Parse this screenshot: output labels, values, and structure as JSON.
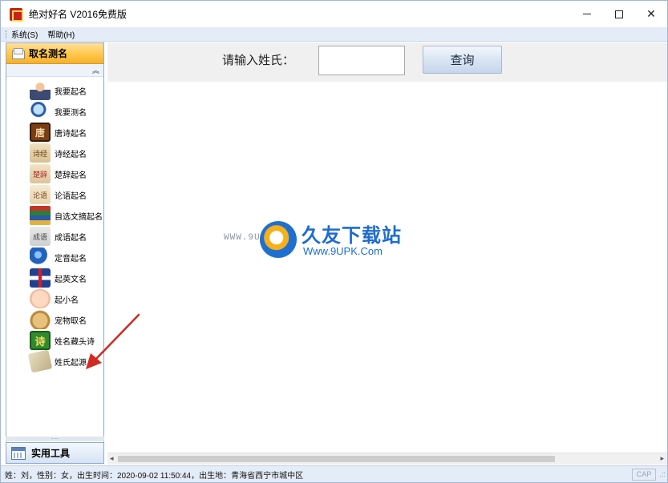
{
  "window": {
    "title": "绝对好名 V2016免费版",
    "controls": {
      "minimize": "",
      "maximize": "",
      "close": "✕"
    }
  },
  "menu": {
    "items": [
      "系统(S)",
      "帮助(H)"
    ]
  },
  "sidebar": {
    "header": "取名测名",
    "collapse_glyph": "︽",
    "items": [
      {
        "label": "我要起名",
        "icon": "person-icon"
      },
      {
        "label": "我要测名",
        "icon": "magnifier-icon"
      },
      {
        "label": "唐诗起名",
        "icon": "tang-icon",
        "glyph": "唐"
      },
      {
        "label": "诗经起名",
        "icon": "scroll-icon",
        "glyph": "诗经"
      },
      {
        "label": "楚辞起名",
        "icon": "scroll-icon",
        "glyph": "楚辞"
      },
      {
        "label": "论语起名",
        "icon": "scroll-icon",
        "glyph": "论语"
      },
      {
        "label": "自选文摘起名",
        "icon": "books-icon"
      },
      {
        "label": "成语起名",
        "icon": "idiom-icon",
        "glyph": "成语"
      },
      {
        "label": "定音起名",
        "icon": "globe-icon"
      },
      {
        "label": "起英文名",
        "icon": "uk-flag-icon"
      },
      {
        "label": "起小名",
        "icon": "baby-icon"
      },
      {
        "label": "宠物取名",
        "icon": "dog-icon"
      },
      {
        "label": "姓名藏头诗",
        "icon": "poem-icon",
        "glyph": "诗"
      },
      {
        "label": "姓氏起源",
        "icon": "ancient-scroll-icon"
      }
    ],
    "splitter": "......",
    "footer": "实用工具"
  },
  "query": {
    "label": "请输入姓氏：",
    "input_value": "",
    "button": "查询"
  },
  "watermark": {
    "url_left": "WWW.9UPK.COM",
    "title": "久友下载站",
    "url": "Www.9UPK.Com"
  },
  "scrollbar": {
    "left": "◂",
    "right": "▸"
  },
  "status": {
    "text": "姓：刘，性别：女，出生时间：2020-09-02 11:50:44，出生地：青海省西宁市城中区",
    "cap": "CAP",
    "grip": ".::"
  },
  "colors": {
    "accent": "#ffc84a",
    "chrome": "#e4ecf7",
    "watermark_blue": "#1d6cd1",
    "arrow_red": "#d22a22"
  }
}
